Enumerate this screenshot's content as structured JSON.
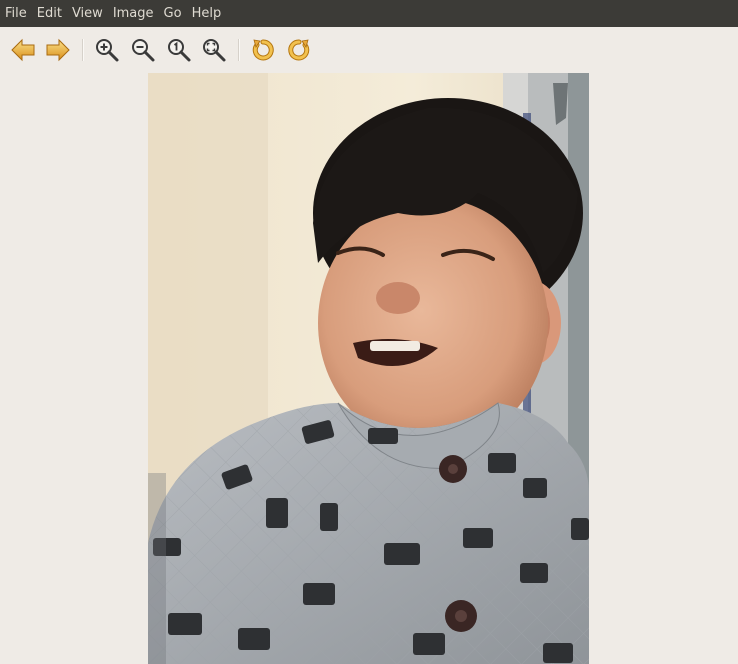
{
  "menu": {
    "items": [
      "File",
      "Edit",
      "View",
      "Image",
      "Go",
      "Help"
    ]
  },
  "toolbar": {
    "buttons": [
      {
        "name": "back-button",
        "icon": "arrow-left-icon"
      },
      {
        "name": "forward-button",
        "icon": "arrow-right-icon"
      },
      {
        "name": "zoom-in-button",
        "icon": "zoom-in-icon"
      },
      {
        "name": "zoom-out-button",
        "icon": "zoom-out-icon"
      },
      {
        "name": "zoom-normal-button",
        "icon": "zoom-original-icon"
      },
      {
        "name": "zoom-fit-button",
        "icon": "zoom-fit-icon"
      },
      {
        "name": "rotate-left-button",
        "icon": "rotate-ccw-icon"
      },
      {
        "name": "rotate-right-button",
        "icon": "rotate-cw-icon"
      }
    ]
  },
  "colors": {
    "menubar_bg": "#3c3b37",
    "menubar_text": "#dfdbd2",
    "window_bg": "#efebe6",
    "icon_accent": "#e8a93a"
  },
  "image": {
    "subject": "photo-child-smiling"
  }
}
